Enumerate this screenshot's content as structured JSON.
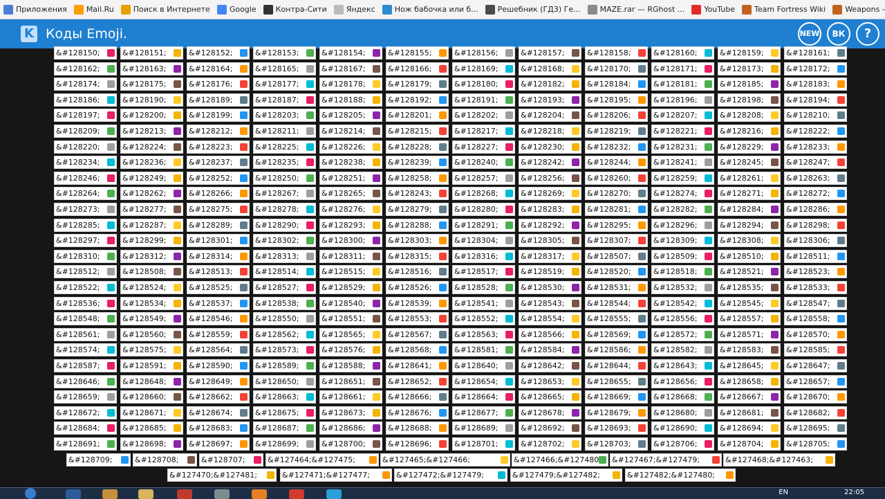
{
  "bookmarks": [
    {
      "label": "Приложения",
      "icon": "apps-grid-icon",
      "color": "#4a7fd6"
    },
    {
      "label": "Mail.Ru",
      "icon": "mailru-icon",
      "color": "#ff9e00"
    },
    {
      "label": "Поиск в Интернете",
      "icon": "search-icon",
      "color": "#e8a000"
    },
    {
      "label": "Google",
      "icon": "google-icon",
      "color": "#4285f4"
    },
    {
      "label": "Контра-Сити",
      "icon": "kontra-icon",
      "color": "#333333"
    },
    {
      "label": "Яндекс",
      "icon": "page-icon",
      "color": "#bbbbbb"
    },
    {
      "label": "Нож бабочка или б...",
      "icon": "butterfly-knife-icon",
      "color": "#2e8bd0"
    },
    {
      "label": "Решебник (ГДЗ) Ге...",
      "icon": "check-icon",
      "color": "#4a4a4a"
    },
    {
      "label": "MAZE.rar — RGhost ...",
      "icon": "rghost-icon",
      "color": "#8a8a8a"
    },
    {
      "label": "YouTube",
      "icon": "youtube-icon",
      "color": "#e52d27"
    },
    {
      "label": "Team Fortress Wiki",
      "icon": "tf2-icon",
      "color": "#c1621d"
    },
    {
      "label": "Weapons - Official T...",
      "icon": "tf2-icon",
      "color": "#c1621d"
    }
  ],
  "header": {
    "title": "Коды Emoji.",
    "new_label": "NEW",
    "vk_label": "ВК",
    "help_label": "?"
  },
  "rows": [
    [
      "&#128150;",
      "&#128151;",
      "&#128152;",
      "&#128153;",
      "&#128154;",
      "&#128155;",
      "&#128156;",
      "&#128157;",
      "&#128158;",
      "&#128160;",
      "&#128159;",
      "&#128161;"
    ],
    [
      "&#128162;",
      "&#128163;",
      "&#128164;",
      "&#128165;",
      "&#128167;",
      "&#128166;",
      "&#128169;",
      "&#128168;",
      "&#128170;",
      "&#128171;",
      "&#128173;",
      "&#128172;"
    ],
    [
      "&#128174;",
      "&#128175;",
      "&#128176;",
      "&#128177;",
      "&#128178;",
      "&#128179;",
      "&#128180;",
      "&#128182;",
      "&#128184;",
      "&#128181;",
      "&#128185;",
      "&#128183;"
    ],
    [
      "&#128186;",
      "&#128190;",
      "&#128189;",
      "&#128187;",
      "&#128188;",
      "&#128192;",
      "&#128191;",
      "&#128193;",
      "&#128195;",
      "&#128196;",
      "&#128198;",
      "&#128194;"
    ],
    [
      "&#128197;",
      "&#128200;",
      "&#128199;",
      "&#128203;",
      "&#128205;",
      "&#128201;",
      "&#128202;",
      "&#128204;",
      "&#128206;",
      "&#128207;",
      "&#128208;",
      "&#128210;"
    ],
    [
      "&#128209;",
      "&#128213;",
      "&#128212;",
      "&#128211;",
      "&#128214;",
      "&#128215;",
      "&#128217;",
      "&#128218;",
      "&#128219;",
      "&#128221;",
      "&#128216;",
      "&#128222;"
    ],
    [
      "&#128220;",
      "&#128224;",
      "&#128223;",
      "&#128225;",
      "&#128226;",
      "&#128228;",
      "&#128227;",
      "&#128230;",
      "&#128232;",
      "&#128231;",
      "&#128229;",
      "&#128233;"
    ],
    [
      "&#128234;",
      "&#128236;",
      "&#128237;",
      "&#128235;",
      "&#128238;",
      "&#128239;",
      "&#128240;",
      "&#128242;",
      "&#128244;",
      "&#128241;",
      "&#128245;",
      "&#128247;"
    ],
    [
      "&#128246;",
      "&#128249;",
      "&#128252;",
      "&#128250;",
      "&#128251;",
      "&#128258;",
      "&#128257;",
      "&#128256;",
      "&#128260;",
      "&#128259;",
      "&#128261;",
      "&#128263;"
    ],
    [
      "&#128264;",
      "&#128262;",
      "&#128266;",
      "&#128267;",
      "&#128265;",
      "&#128243;",
      "&#128268;",
      "&#128269;",
      "&#128270;",
      "&#128274;",
      "&#128271;",
      "&#128272;"
    ],
    [
      "&#128273;",
      "&#128277;",
      "&#128275;",
      "&#128278;",
      "&#128276;",
      "&#128279;",
      "&#128280;",
      "&#128283;",
      "&#128281;",
      "&#128282;",
      "&#128284;",
      "&#128286;"
    ],
    [
      "&#128285;",
      "&#128287;",
      "&#128289;",
      "&#128290;",
      "&#128293;",
      "&#128288;",
      "&#128291;",
      "&#128292;",
      "&#128295;",
      "&#128296;",
      "&#128294;",
      "&#128298;"
    ],
    [
      "&#128297;",
      "&#128299;",
      "&#128301;",
      "&#128302;",
      "&#128300;",
      "&#128303;",
      "&#128304;",
      "&#128305;",
      "&#128307;",
      "&#128309;",
      "&#128308;",
      "&#128306;"
    ],
    [
      "&#128310;",
      "&#128312;",
      "&#128314;",
      "&#128313;",
      "&#128311;",
      "&#128315;",
      "&#128316;",
      "&#128317;",
      "&#128507;",
      "&#128509;",
      "&#128510;",
      "&#128511;"
    ],
    [
      "&#128512;",
      "&#128508;",
      "&#128513;",
      "&#128514;",
      "&#128515;",
      "&#128516;",
      "&#128517;",
      "&#128519;",
      "&#128520;",
      "&#128518;",
      "&#128521;",
      "&#128523;"
    ],
    [
      "&#128522;",
      "&#128524;",
      "&#128525;",
      "&#128527;",
      "&#128529;",
      "&#128526;",
      "&#128528;",
      "&#128530;",
      "&#128531;",
      "&#128532;",
      "&#128535;",
      "&#128533;"
    ],
    [
      "&#128536;",
      "&#128534;",
      "&#128537;",
      "&#128538;",
      "&#128540;",
      "&#128539;",
      "&#128541;",
      "&#128543;",
      "&#128544;",
      "&#128542;",
      "&#128545;",
      "&#128547;"
    ],
    [
      "&#128548;",
      "&#128549;",
      "&#128546;",
      "&#128550;",
      "&#128551;",
      "&#128553;",
      "&#128552;",
      "&#128554;",
      "&#128555;",
      "&#128556;",
      "&#128557;",
      "&#128558;"
    ],
    [
      "&#128561;",
      "&#128560;",
      "&#128559;",
      "&#128562;",
      "&#128565;",
      "&#128567;",
      "&#128563;",
      "&#128566;",
      "&#128569;",
      "&#128572;",
      "&#128571;",
      "&#128570;"
    ],
    [
      "&#128574;",
      "&#128575;",
      "&#128564;",
      "&#128573;",
      "&#128576;",
      "&#128568;",
      "&#128581;",
      "&#128584;",
      "&#128586;",
      "&#128582;",
      "&#128583;",
      "&#128585;"
    ],
    [
      "&#128587;",
      "&#128591;",
      "&#128590;",
      "&#128589;",
      "&#128588;",
      "&#128641;",
      "&#128640;",
      "&#128642;",
      "&#128644;",
      "&#128643;",
      "&#128645;",
      "&#128647;"
    ],
    [
      "&#128646;",
      "&#128648;",
      "&#128649;",
      "&#128650;",
      "&#128651;",
      "&#128652;",
      "&#128654;",
      "&#128653;",
      "&#128655;",
      "&#128656;",
      "&#128658;",
      "&#128657;"
    ],
    [
      "&#128659;",
      "&#128660;",
      "&#128662;",
      "&#128663;",
      "&#128661;",
      "&#128666;",
      "&#128664;",
      "&#128665;",
      "&#128669;",
      "&#128668;",
      "&#128667;",
      "&#128670;"
    ],
    [
      "&#128672;",
      "&#128671;",
      "&#128674;",
      "&#128675;",
      "&#128673;",
      "&#128676;",
      "&#128677;",
      "&#128678;",
      "&#128679;",
      "&#128680;",
      "&#128681;",
      "&#128682;"
    ],
    [
      "&#128684;",
      "&#128685;",
      "&#128683;",
      "&#128687;",
      "&#128686;",
      "&#128688;",
      "&#128689;",
      "&#128692;",
      "&#128693;",
      "&#128690;",
      "&#128694;",
      "&#128695;"
    ],
    [
      "&#128691;",
      "&#128698;",
      "&#128697;",
      "&#128699;",
      "&#128700;",
      "&#128696;",
      "&#128701;",
      "&#128702;",
      "&#128703;",
      "&#128706;",
      "&#128704;",
      "&#128705;"
    ]
  ],
  "row27": [
    "&#128709;",
    "&#128708;",
    "&#128707;",
    "&#127464;&#127475;",
    "&#127465;&#127466;",
    "&#127466;&#127480;",
    "&#127467;&#127479;",
    "&#127468;&#127463;"
  ],
  "row28": [
    "&#127470;&#127481;",
    "&#127471;&#127477;",
    "&#127472;&#127479;",
    "&#127479;&#127482;",
    "&#127482;&#127480;"
  ],
  "emoji_colors": [
    "#e91e63",
    "#f4b400",
    "#2196f3",
    "#4caf50",
    "#8e24aa",
    "#ff9800",
    "#9e9e9e",
    "#795548",
    "#f44336",
    "#00bcd4",
    "#ffca28",
    "#607d8b"
  ],
  "taskbar": {
    "lang": "EN",
    "time": "22:05"
  }
}
